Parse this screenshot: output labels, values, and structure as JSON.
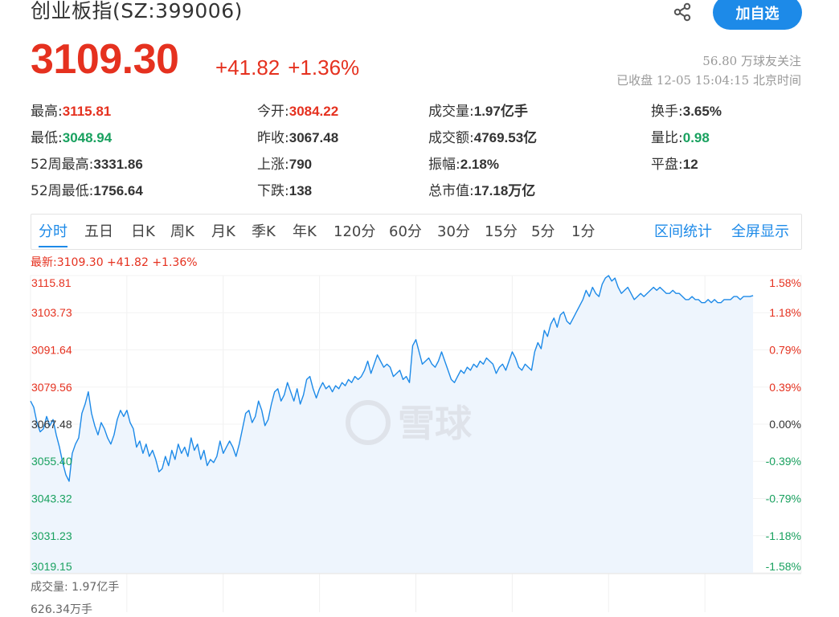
{
  "header": {
    "title": "创业板指(SZ:399006)",
    "add_button": "加自选",
    "share_icon": "share-icon"
  },
  "quote": {
    "price": "3109.30",
    "change": "+41.82",
    "change_pct": "+1.36%",
    "followers": "56.80 万球友关注",
    "status": "已收盘 12-05 15:04:15 北京时间"
  },
  "stats": [
    {
      "label": "最高:",
      "value": "3115.81",
      "tone": "red"
    },
    {
      "label": "今开:",
      "value": "3084.22",
      "tone": "red"
    },
    {
      "label": "成交量:",
      "value": "1.97亿手",
      "tone": ""
    },
    {
      "label": "换手:",
      "value": "3.65%",
      "tone": ""
    },
    {
      "label": "最低:",
      "value": "3048.94",
      "tone": "green"
    },
    {
      "label": "昨收:",
      "value": "3067.48",
      "tone": ""
    },
    {
      "label": "成交额:",
      "value": "4769.53亿",
      "tone": ""
    },
    {
      "label": "量比:",
      "value": "0.98",
      "tone": "green"
    },
    {
      "label": "52周最高:",
      "value": "3331.86",
      "tone": ""
    },
    {
      "label": "上涨:",
      "value": "790",
      "tone": ""
    },
    {
      "label": "振幅:",
      "value": "2.18%",
      "tone": ""
    },
    {
      "label": "平盘:",
      "value": "12",
      "tone": ""
    },
    {
      "label": "52周最低:",
      "value": "1756.64",
      "tone": ""
    },
    {
      "label": "下跌:",
      "value": "138",
      "tone": ""
    },
    {
      "label": "总市值:",
      "value": "17.18万亿",
      "tone": ""
    }
  ],
  "tabs": [
    "分时",
    "五日",
    "日K",
    "周K",
    "月K",
    "季K",
    "年K",
    "120分",
    "60分",
    "30分",
    "15分",
    "5分",
    "1分"
  ],
  "tab_links": [
    "区间统计",
    "全屏显示"
  ],
  "active_tab": "分时",
  "chart_header": "最新:3109.30 +41.82 +1.36%",
  "volume": {
    "label": "成交量: 1.97亿手",
    "tick": "626.34万手"
  },
  "watermark": "雪球",
  "colors": {
    "up": "#e5311f",
    "down": "#19a15f",
    "accent": "#1d8ae8",
    "line": "#1d8ae8",
    "fill": "#eef5fd"
  },
  "chart_data": {
    "type": "area",
    "title": "",
    "ylim": [
      3019.15,
      3115.81
    ],
    "y_ticks_left": [
      "3115.81",
      "3103.73",
      "3091.64",
      "3079.56",
      "3067.48",
      "3055.40",
      "3043.32",
      "3031.23",
      "3019.15"
    ],
    "y_ticks_right": [
      "1.58%",
      "1.18%",
      "0.79%",
      "0.39%",
      "0.00%",
      "-0.39%",
      "-0.79%",
      "-1.18%",
      "-1.58%"
    ],
    "baseline": 3067.48,
    "session_minutes": 241,
    "series": [
      {
        "values": [
          3075,
          3073,
          3068,
          3065,
          3066,
          3070,
          3067,
          3069,
          3064,
          3060,
          3055,
          3051,
          3048.94,
          3058,
          3061,
          3063,
          3071,
          3074,
          3078,
          3071,
          3067,
          3064,
          3068,
          3066,
          3063,
          3061,
          3064,
          3069,
          3072,
          3070,
          3072,
          3068,
          3066,
          3060,
          3062,
          3058,
          3061,
          3057,
          3059,
          3056,
          3052,
          3053,
          3057,
          3054,
          3059,
          3056,
          3061,
          3058,
          3060,
          3057,
          3063,
          3059,
          3061,
          3056,
          3059,
          3054,
          3056,
          3055,
          3057,
          3062,
          3058,
          3060,
          3062,
          3060,
          3057,
          3061,
          3066,
          3071,
          3072,
          3068,
          3070,
          3075,
          3072,
          3067,
          3069,
          3074,
          3078,
          3079,
          3075,
          3077,
          3081,
          3078,
          3075,
          3079,
          3074,
          3077,
          3082,
          3083,
          3079,
          3076,
          3079,
          3081,
          3079,
          3080,
          3078,
          3080,
          3079,
          3081,
          3080,
          3082,
          3081,
          3083,
          3082,
          3083,
          3085,
          3088,
          3084,
          3087,
          3090,
          3088,
          3086,
          3087,
          3086,
          3083,
          3084,
          3085,
          3082,
          3083,
          3081,
          3093,
          3095,
          3091,
          3087,
          3088,
          3089,
          3087,
          3086,
          3088,
          3091,
          3088,
          3085,
          3082,
          3081,
          3083,
          3085,
          3084,
          3086,
          3085,
          3087,
          3086,
          3088,
          3087,
          3089,
          3088,
          3087,
          3084,
          3086,
          3087,
          3085,
          3088,
          3091,
          3089,
          3086,
          3085,
          3087,
          3086,
          3085,
          3091,
          3094,
          3092,
          3098,
          3096,
          3100,
          3102,
          3099,
          3103,
          3104,
          3101,
          3100,
          3102,
          3104,
          3106,
          3108,
          3111,
          3109,
          3112,
          3110,
          3109,
          3113,
          3115,
          3115.81,
          3114,
          3115,
          3112,
          3110,
          3111,
          3112,
          3110,
          3108,
          3109,
          3110,
          3109,
          3110,
          3111,
          3112,
          3111,
          3112,
          3111,
          3110,
          3110,
          3111,
          3110,
          3110,
          3109,
          3108,
          3108,
          3109,
          3108,
          3108,
          3107,
          3107,
          3108,
          3107,
          3108,
          3107,
          3107,
          3108,
          3108,
          3108,
          3109,
          3109,
          3108,
          3109,
          3109,
          3109,
          3109.3
        ]
      }
    ],
    "grid": true
  }
}
